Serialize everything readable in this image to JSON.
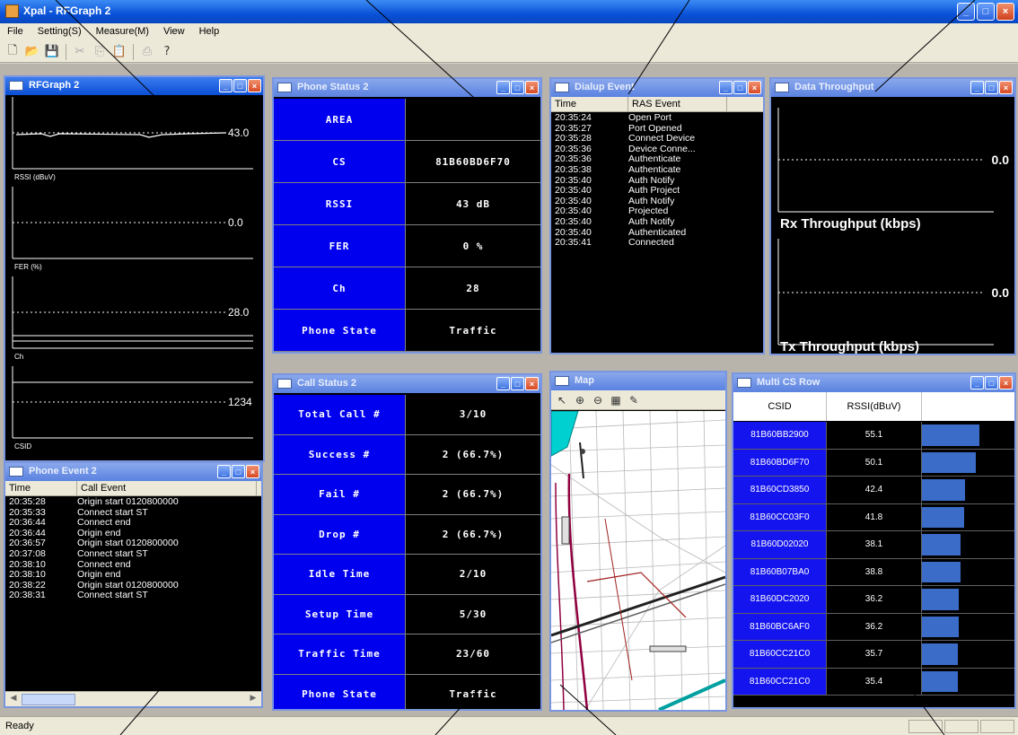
{
  "window": {
    "title": "Xpal - RFGraph 2"
  },
  "menu": [
    {
      "label": "File"
    },
    {
      "label": "Setting(S)"
    },
    {
      "label": "Measure(M)"
    },
    {
      "label": "View"
    },
    {
      "label": "Help"
    }
  ],
  "toolbar": {
    "icons": [
      "new-icon",
      "open-icon",
      "save-icon",
      "cut-icon",
      "copy-icon",
      "paste-icon",
      "print-icon",
      "about-icon"
    ]
  },
  "windows": {
    "rfgraph": {
      "title": "RFGraph 2",
      "panels": [
        {
          "label": "RSSI (dBuV)",
          "value": "43.0",
          "level": 0.5
        },
        {
          "label": "FER (%)",
          "value": "0.0",
          "level": 0.5
        },
        {
          "label": "Ch",
          "value": "28.0",
          "level": 0.5
        },
        {
          "label": "CSID",
          "value": "1234",
          "level": 0.5
        }
      ]
    },
    "phone_status": {
      "title": "Phone Status 2",
      "rows": [
        {
          "label": "AREA",
          "value": ""
        },
        {
          "label": "CS",
          "value": "81B60BD6F70"
        },
        {
          "label": "RSSI",
          "value": "43 dB"
        },
        {
          "label": "FER",
          "value": "0 %"
        },
        {
          "label": "Ch",
          "value": "28"
        },
        {
          "label": "Phone State",
          "value": "Traffic"
        }
      ]
    },
    "dialup_event": {
      "title": "Dialup Event",
      "columns": [
        "Time",
        "RAS Event"
      ],
      "rows": [
        {
          "time": "20:35:24",
          "event": "Open Port"
        },
        {
          "time": "20:35:27",
          "event": "Port Opened"
        },
        {
          "time": "20:35:28",
          "event": "Connect Device"
        },
        {
          "time": "20:35:36",
          "event": "Device Conne..."
        },
        {
          "time": "20:35:36",
          "event": "Authenticate"
        },
        {
          "time": "20:35:38",
          "event": "Authenticate"
        },
        {
          "time": "20:35:40",
          "event": "Auth Notify"
        },
        {
          "time": "20:35:40",
          "event": "Auth Project"
        },
        {
          "time": "20:35:40",
          "event": "Auth Notify"
        },
        {
          "time": "20:35:40",
          "event": "Projected"
        },
        {
          "time": "20:35:40",
          "event": "Auth Notify"
        },
        {
          "time": "20:35:40",
          "event": "Authenticated"
        },
        {
          "time": "20:35:41",
          "event": "Connected"
        }
      ]
    },
    "data_throughput": {
      "title": "Data Throughput",
      "rx": {
        "label": "Rx Throughput (kbps)",
        "value": "0.0"
      },
      "tx": {
        "label": "Tx Throughput (kbps)",
        "value": "0.0"
      }
    },
    "phone_event": {
      "title": "Phone Event 2",
      "columns": [
        "Time",
        "Call Event"
      ],
      "rows": [
        {
          "time": "20:35:28",
          "event": "Origin start 0120800000"
        },
        {
          "time": "20:35:33",
          "event": "Connect start ST"
        },
        {
          "time": "20:36:44",
          "event": "Connect end"
        },
        {
          "time": "20:36:44",
          "event": "Origin end"
        },
        {
          "time": "20:36:57",
          "event": "Origin start 0120800000"
        },
        {
          "time": "20:37:08",
          "event": "Connect start ST"
        },
        {
          "time": "20:38:10",
          "event": "Connect end"
        },
        {
          "time": "20:38:10",
          "event": "Origin end"
        },
        {
          "time": "20:38:22",
          "event": "Origin start 0120800000"
        },
        {
          "time": "20:38:31",
          "event": "Connect start ST"
        }
      ]
    },
    "call_status": {
      "title": "Call Status 2",
      "rows": [
        {
          "label": "Total Call #",
          "value": "3/10"
        },
        {
          "label": "Success #",
          "value": "2 (66.7%)"
        },
        {
          "label": "Fail #",
          "value": "2 (66.7%)"
        },
        {
          "label": "Drop #",
          "value": "2 (66.7%)"
        },
        {
          "label": "Idle Time",
          "value": "2/10"
        },
        {
          "label": "Setup Time",
          "value": "5/30"
        },
        {
          "label": "Traffic Time",
          "value": "23/60"
        },
        {
          "label": "Phone State",
          "value": "Traffic"
        }
      ]
    },
    "map": {
      "title": "Map",
      "tools": [
        "pointer-icon",
        "zoom-in-icon",
        "zoom-out-icon",
        "grid-icon",
        "edit-icon"
      ]
    },
    "multi_cs": {
      "title": "Multi CS Row",
      "columns": [
        "CSID",
        "RSSI(dBuV)"
      ],
      "rows": [
        {
          "csid": "81B60BB2900",
          "rssi": "55.1",
          "level": 0.62
        },
        {
          "csid": "81B60BD6F70",
          "rssi": "50.1",
          "level": 0.58
        },
        {
          "csid": "81B60CD3850",
          "rssi": "42.4",
          "level": 0.47
        },
        {
          "csid": "81B60CC03F0",
          "rssi": "41.8",
          "level": 0.46
        },
        {
          "csid": "81B60D02020",
          "rssi": "38.1",
          "level": 0.42
        },
        {
          "csid": "81B60B07BA0",
          "rssi": "38.8",
          "level": 0.42
        },
        {
          "csid": "81B60DC2020",
          "rssi": "36.2",
          "level": 0.4
        },
        {
          "csid": "81B60BC6AF0",
          "rssi": "36.2",
          "level": 0.4
        },
        {
          "csid": "81B60CC21C0",
          "rssi": "35.7",
          "level": 0.39
        },
        {
          "csid": "81B60CC21C0",
          "rssi": "35.4",
          "level": 0.39
        }
      ]
    }
  },
  "status": {
    "text": "Ready"
  },
  "colors": {
    "label_blue": "#0000ee",
    "bar_blue": "#3a6cc8",
    "xp_title": "#0a52d8"
  }
}
